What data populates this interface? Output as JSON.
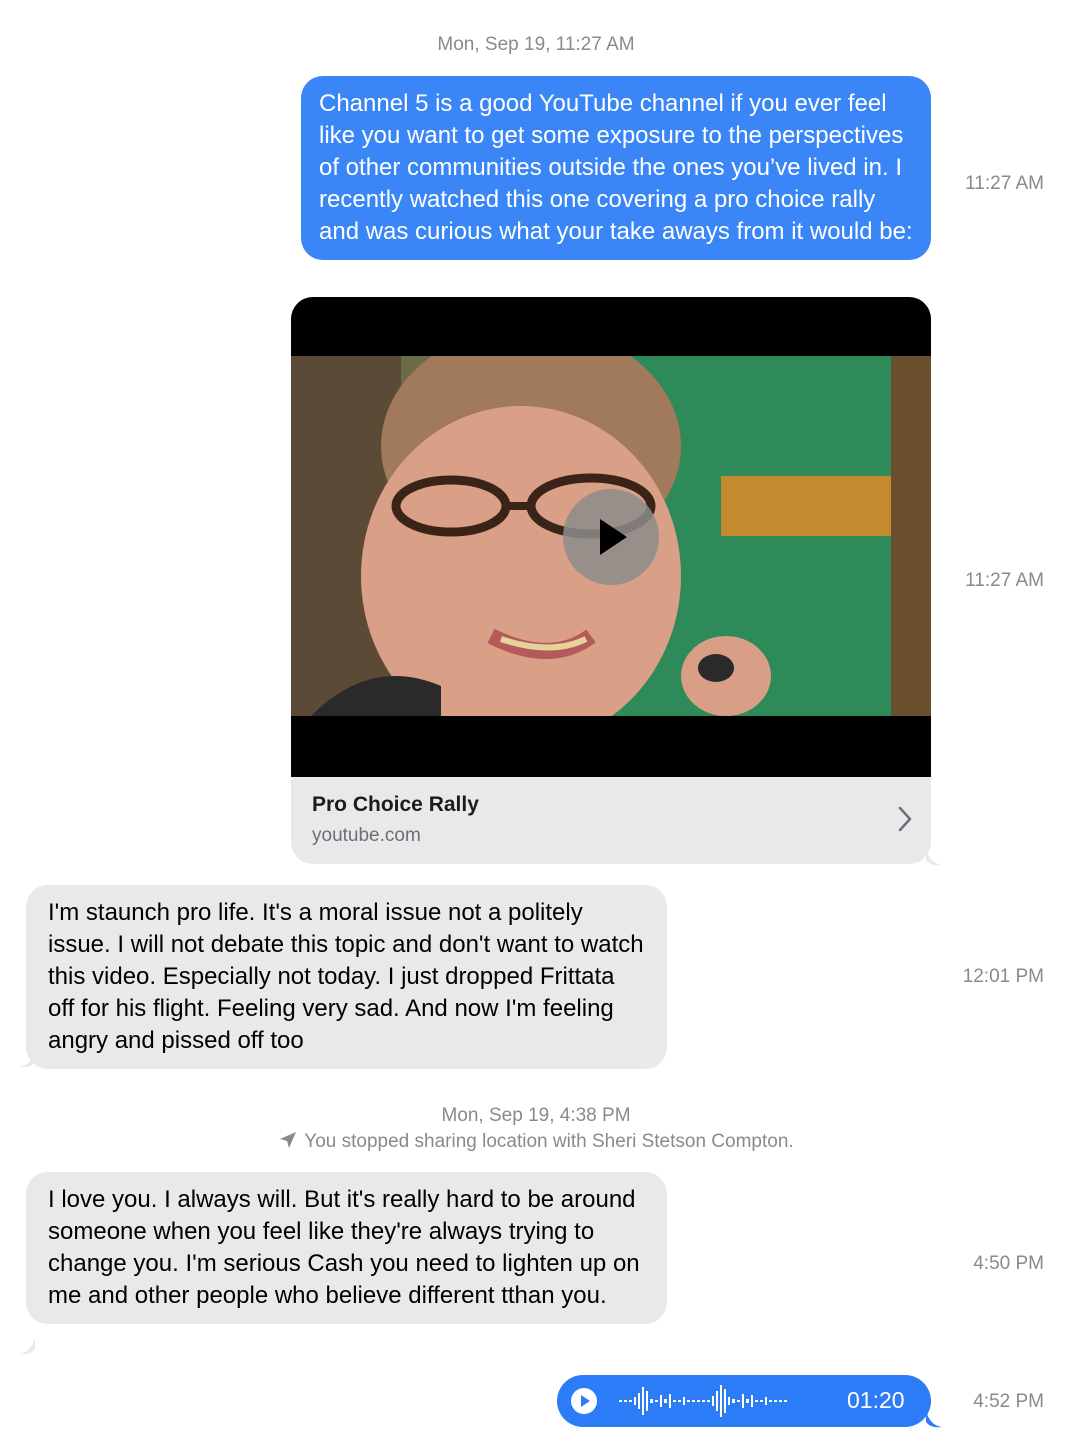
{
  "thread": {
    "date_header_1": "Mon, Sep 19, 11:27 AM",
    "msg1": {
      "text": "Channel 5 is a good YouTube channel if you ever feel like you want to get some exposure to the perspectives of other communities outside the ones you’ve lived in. I recently watched this one covering a pro choice rally and was curious what your take aways from it would be:",
      "time": "11:27 AM"
    },
    "link_preview": {
      "title": "Pro Choice Rally",
      "domain": "youtube.com",
      "time": "11:27 AM"
    },
    "msg2": {
      "text": "I'm staunch pro life. It's a moral issue not a politely issue. I will not debate this topic and don't want to watch this video. Especially not today. I just dropped Frittata off for his flight. Feeling very sad. And now I'm feeling angry and pissed off too",
      "time": "12:01 PM"
    },
    "date_header_2": "Mon, Sep 19, 4:38 PM",
    "location_notice": "You stopped sharing location with Sheri Stetson Compton.",
    "msg3": {
      "text": "I love you. I always will. But it's really hard to be around someone when you feel like they're always trying to change you. I'm serious Cash you need to lighten up on me and other people who believe different tthan you.",
      "time": "4:50 PM"
    },
    "audio_msg": {
      "duration": "01:20",
      "time": "4:52 PM"
    }
  },
  "colors": {
    "outgoing": "#3a86f7",
    "incoming": "#e9e9eb",
    "meta": "#8a8a8e"
  },
  "icons": [
    "location-arrow-icon",
    "play-icon",
    "chevron-right-icon",
    "waveform-icon"
  ]
}
